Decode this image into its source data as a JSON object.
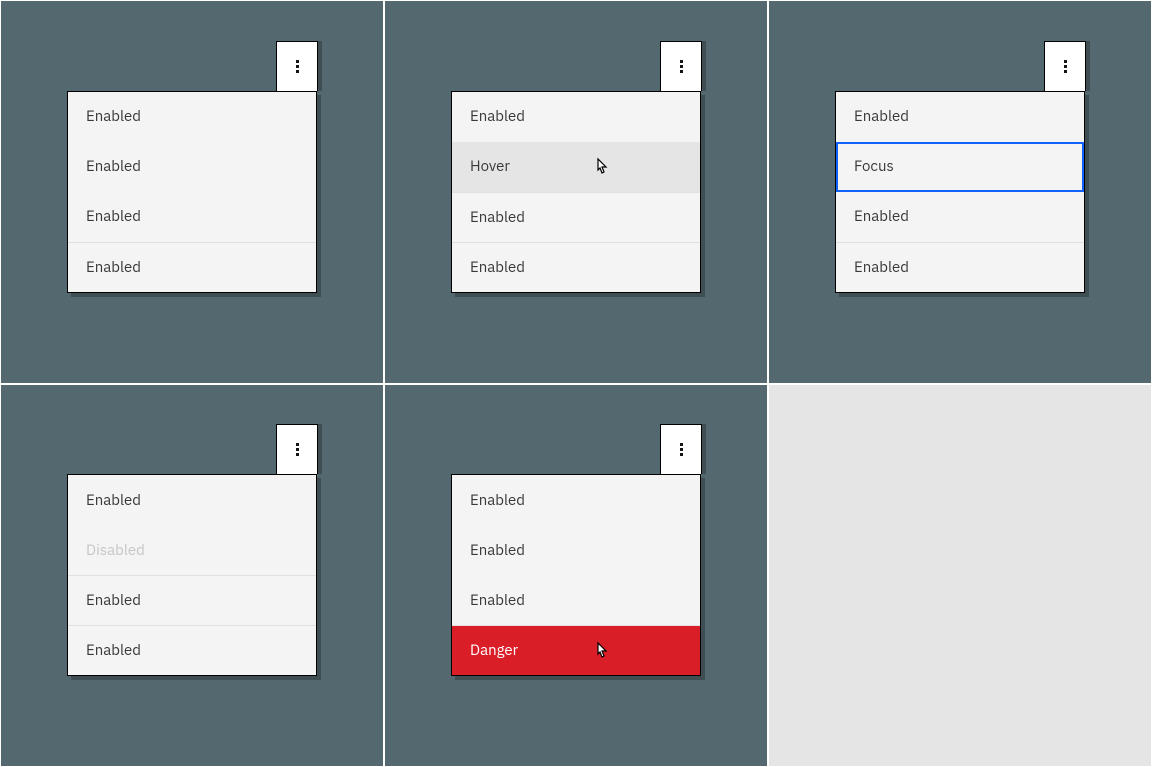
{
  "panels": {
    "default": {
      "items": [
        {
          "label": "Enabled",
          "state": "enabled"
        },
        {
          "label": "Enabled",
          "state": "enabled"
        },
        {
          "label": "Enabled",
          "state": "enabled"
        },
        {
          "label": "Enabled",
          "state": "enabled"
        }
      ]
    },
    "hover": {
      "items": [
        {
          "label": "Enabled",
          "state": "enabled"
        },
        {
          "label": "Hover",
          "state": "hover"
        },
        {
          "label": "Enabled",
          "state": "enabled"
        },
        {
          "label": "Enabled",
          "state": "enabled"
        }
      ]
    },
    "focus": {
      "items": [
        {
          "label": "Enabled",
          "state": "enabled"
        },
        {
          "label": "Focus",
          "state": "focus"
        },
        {
          "label": "Enabled",
          "state": "enabled"
        },
        {
          "label": "Enabled",
          "state": "enabled"
        }
      ]
    },
    "disabled": {
      "items": [
        {
          "label": "Enabled",
          "state": "enabled"
        },
        {
          "label": "Disabled",
          "state": "disabled"
        },
        {
          "label": "Enabled",
          "state": "enabled"
        },
        {
          "label": "Enabled",
          "state": "enabled"
        }
      ]
    },
    "danger": {
      "items": [
        {
          "label": "Enabled",
          "state": "enabled"
        },
        {
          "label": "Enabled",
          "state": "enabled"
        },
        {
          "label": "Enabled",
          "state": "enabled"
        },
        {
          "label": "Danger",
          "state": "danger"
        }
      ]
    }
  },
  "colors": {
    "background": "#53696f",
    "empty": "#e5e5e5",
    "menu_bg": "#f4f4f4",
    "hover_bg": "#e5e5e5",
    "focus_ring": "#0f62fe",
    "danger_bg": "#da1e28",
    "text": "#393939",
    "disabled_text": "#c6c6c6"
  }
}
